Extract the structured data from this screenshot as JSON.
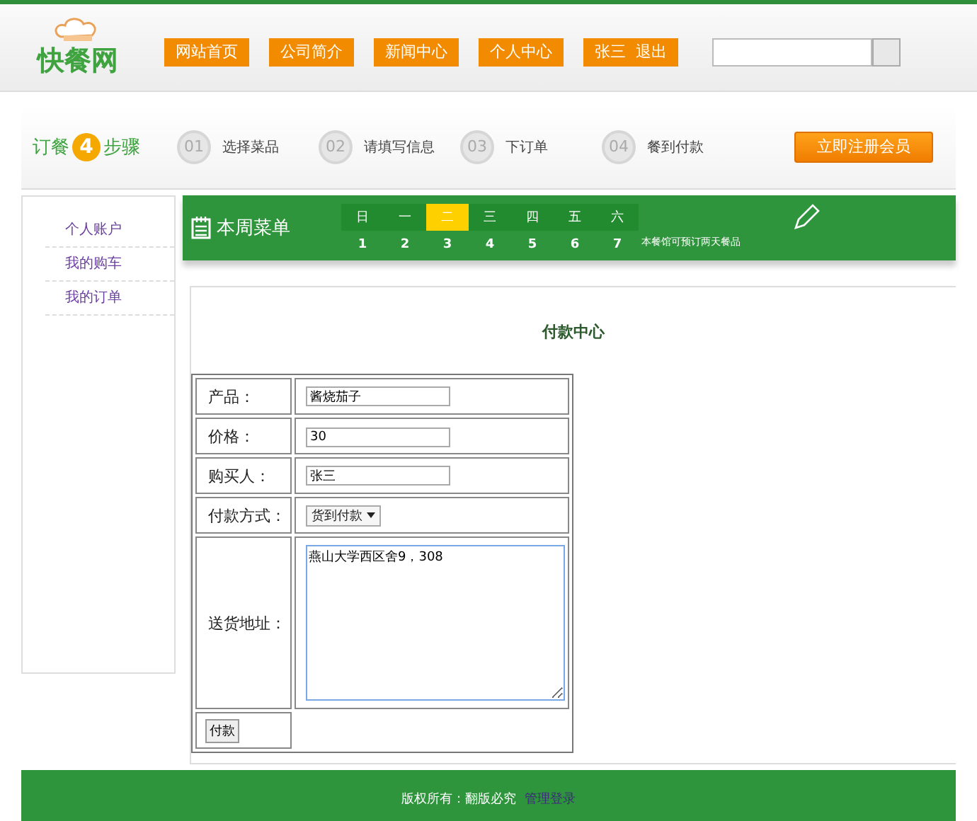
{
  "header": {
    "logo": "快餐网",
    "nav": [
      "网站首页",
      "公司简介",
      "新闻中心",
      "个人中心",
      "张三  退出"
    ]
  },
  "steps": {
    "title_before": "订餐",
    "title_number": "4",
    "title_after": "步骤",
    "items": [
      {
        "number": "01",
        "label": "选择菜品"
      },
      {
        "number": "02",
        "label": "请填写信息"
      },
      {
        "number": "03",
        "label": "下订单"
      },
      {
        "number": "04",
        "label": "餐到付款"
      }
    ],
    "register_button": "立即注册会员"
  },
  "sidebar": {
    "items": [
      "个人账户",
      "我的购车",
      "我的订单"
    ]
  },
  "menu_banner": {
    "title": "本周菜单",
    "days": [
      {
        "day": "日",
        "date": "1",
        "selected": false
      },
      {
        "day": "一",
        "date": "2",
        "selected": false
      },
      {
        "day": "二",
        "date": "3",
        "selected": true
      },
      {
        "day": "三",
        "date": "4",
        "selected": false
      },
      {
        "day": "四",
        "date": "5",
        "selected": false
      },
      {
        "day": "五",
        "date": "6",
        "selected": false
      },
      {
        "day": "六",
        "date": "7",
        "selected": false
      }
    ],
    "note": "本餐馆可预订两天餐品"
  },
  "payment": {
    "title": "付款中心",
    "rows": [
      {
        "kind": "text",
        "label": "产品：",
        "value": "酱烧茄子"
      },
      {
        "kind": "text",
        "label": "价格：",
        "value": "30"
      },
      {
        "kind": "text",
        "label": "购买人：",
        "value": "张三"
      },
      {
        "kind": "select",
        "label": "付款方式：",
        "value": "货到付款"
      },
      {
        "kind": "textarea",
        "label": "送货地址：",
        "value": "燕山大学西区舍9，308"
      },
      {
        "kind": "button",
        "label": "付款"
      }
    ]
  },
  "footer": {
    "text": "版权所有：翻版必究",
    "link": "管理登录"
  }
}
